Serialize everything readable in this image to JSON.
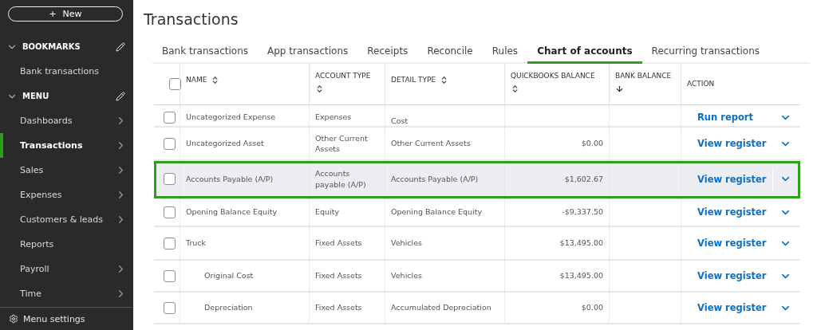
{
  "sidebar": {
    "new_button": {
      "icon": "+",
      "label": "New"
    },
    "sections": [
      {
        "title": "BOOKMARKS",
        "expanded": true,
        "items": [
          {
            "label": "Bank transactions",
            "selected": false,
            "has_submenu": false
          }
        ]
      },
      {
        "title": "MENU",
        "expanded": true,
        "items": [
          {
            "label": "Dashboards",
            "selected": false,
            "has_submenu": true
          },
          {
            "label": "Transactions",
            "selected": true,
            "has_submenu": true
          },
          {
            "label": "Sales",
            "selected": false,
            "has_submenu": true
          },
          {
            "label": "Expenses",
            "selected": false,
            "has_submenu": true
          },
          {
            "label": "Customers & leads",
            "selected": false,
            "has_submenu": true
          },
          {
            "label": "Reports",
            "selected": false,
            "has_submenu": false
          },
          {
            "label": "Payroll",
            "selected": false,
            "has_submenu": true
          },
          {
            "label": "Time",
            "selected": false,
            "has_submenu": true
          }
        ]
      }
    ],
    "footer": "Menu settings"
  },
  "page": {
    "title": "Transactions",
    "tabs": [
      {
        "label": "Bank transactions",
        "selected": false
      },
      {
        "label": "App transactions",
        "selected": false
      },
      {
        "label": "Receipts",
        "selected": false
      },
      {
        "label": "Reconcile",
        "selected": false
      },
      {
        "label": "Rules",
        "selected": false
      },
      {
        "label": "Chart of accounts",
        "selected": true
      },
      {
        "label": "Recurring transactions",
        "selected": false
      }
    ],
    "table": {
      "select_all_checked": false,
      "columns": [
        {
          "label": "NAME",
          "kind": "both"
        },
        {
          "label": "ACCOUNT TYPE",
          "kind": "both"
        },
        {
          "label": "DETAIL TYPE",
          "kind": "both"
        },
        {
          "label": "QUICKBOOKS BALANCE",
          "kind": "both"
        },
        {
          "label": "BANK BALANCE",
          "kind": "down"
        },
        {
          "label": "ACTION",
          "kind": "plain"
        }
      ],
      "rows": [
        {
          "name": "Uncategorized Expense",
          "account_type": "Expenses",
          "detail_type": "Cost",
          "balance": "",
          "action": "Run report",
          "highlighted": false,
          "checked": false
        },
        {
          "name": "Uncategorized Asset",
          "account_type": "Other Current Assets",
          "detail_type": "Other Current Assets",
          "balance": "$0.00",
          "action": "View register",
          "highlighted": false,
          "checked": false
        },
        {
          "name": "Accounts Payable (A/P)",
          "account_type": "Accounts payable (A/P)",
          "detail_type": "Accounts Payable (A/P)",
          "balance": "$1,602.67",
          "action": "View register",
          "highlighted": true,
          "checked": false
        },
        {
          "name": "Opening Balance Equity",
          "account_type": "Equity",
          "detail_type": "Opening Balance Equity",
          "balance": "-$9,337.50",
          "action": "View register",
          "highlighted": false,
          "checked": false
        },
        {
          "name": "Truck",
          "account_type": "Fixed Assets",
          "detail_type": "Vehicles",
          "balance": "$13,495.00",
          "action": "View register",
          "highlighted": false,
          "checked": false,
          "children": [
            {
              "name": "Original Cost",
              "account_type": "Fixed Assets",
              "detail_type": "Vehicles",
              "balance": "$13,495.00",
              "action": "View register",
              "highlighted": false,
              "checked": false
            },
            {
              "name": "Depreciation",
              "account_type": "Fixed Assets",
              "detail_type": "Accumulated Depreciation",
              "balance": "$0.00",
              "action": "View register",
              "highlighted": false,
              "checked": false
            }
          ]
        }
      ]
    }
  }
}
